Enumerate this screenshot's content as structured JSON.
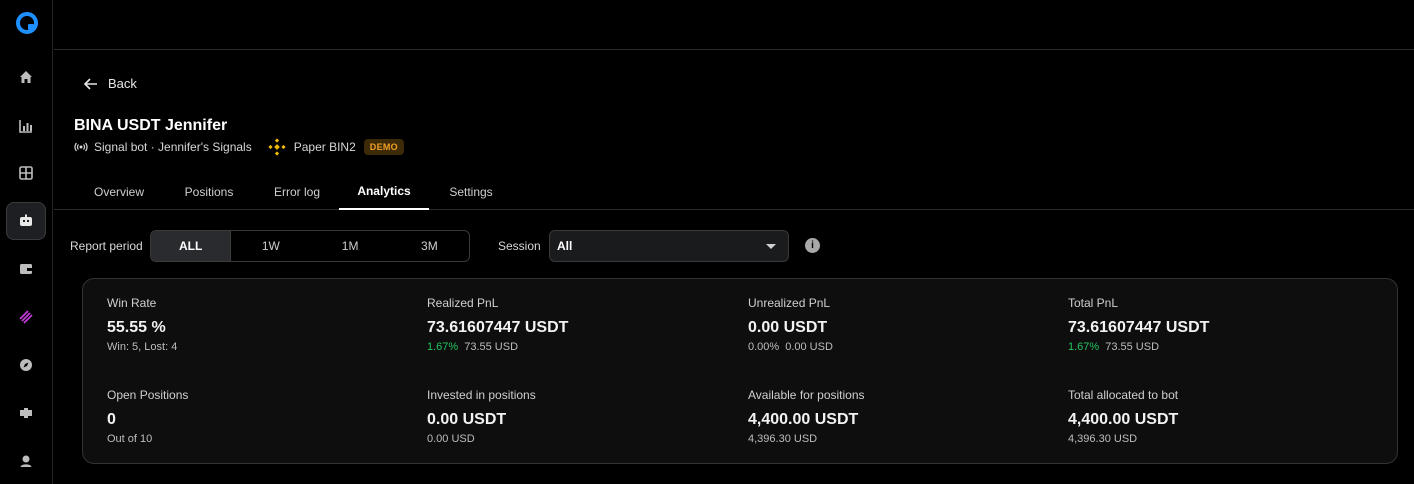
{
  "colors": {
    "accent_blue": "#1e90ff",
    "positive": "#22c55e",
    "demo_badge": "#f0a02a",
    "binance_yellow": "#f0b90b",
    "ai_purple": "#c03bd6"
  },
  "sidebar": {
    "logo": "logo-icon",
    "items": [
      {
        "icon": "home-icon"
      },
      {
        "icon": "chart-icon"
      },
      {
        "icon": "grid-icon"
      },
      {
        "icon": "bot-icon",
        "active": true
      },
      {
        "icon": "wallet-icon"
      },
      {
        "icon": "layers-icon"
      },
      {
        "icon": "compass-icon"
      },
      {
        "icon": "puzzle-icon"
      },
      {
        "icon": "user-icon"
      }
    ]
  },
  "header": {
    "back_label": "Back",
    "title": "BINA USDT Jennifer",
    "bot_type": "Signal bot · Jennifer's Signals",
    "exchange": "Paper BIN2",
    "badge": "DEMO"
  },
  "tabs": [
    "Overview",
    "Positions",
    "Error log",
    "Analytics",
    "Settings"
  ],
  "active_tab": "Analytics",
  "filters": {
    "report_period_label": "Report period",
    "periods": [
      "ALL",
      "1W",
      "1M",
      "3M"
    ],
    "active_period": "ALL",
    "session_label": "Session",
    "session_value": "All"
  },
  "stats": {
    "win_rate": {
      "label": "Win Rate",
      "value": "55.55 %",
      "sub": "Win: 5, Lost: 4"
    },
    "realized_pnl": {
      "label": "Realized PnL",
      "value": "73.61607447 USDT",
      "pct": "1.67%",
      "usd": "73.55 USD"
    },
    "unrealized_pnl": {
      "label": "Unrealized PnL",
      "value": "0.00 USDT",
      "pct": "0.00%",
      "usd": "0.00 USD"
    },
    "total_pnl": {
      "label": "Total PnL",
      "value": "73.61607447 USDT",
      "pct": "1.67%",
      "usd": "73.55 USD"
    },
    "open_positions": {
      "label": "Open Positions",
      "value": "0",
      "sub": "Out of 10"
    },
    "invested": {
      "label": "Invested in positions",
      "value": "0.00 USDT",
      "sub": "0.00 USD"
    },
    "available": {
      "label": "Available for positions",
      "value": "4,400.00 USDT",
      "sub": "4,396.30 USD"
    },
    "allocated": {
      "label": "Total allocated to bot",
      "value": "4,400.00 USDT",
      "sub": "4,396.30 USD"
    }
  }
}
